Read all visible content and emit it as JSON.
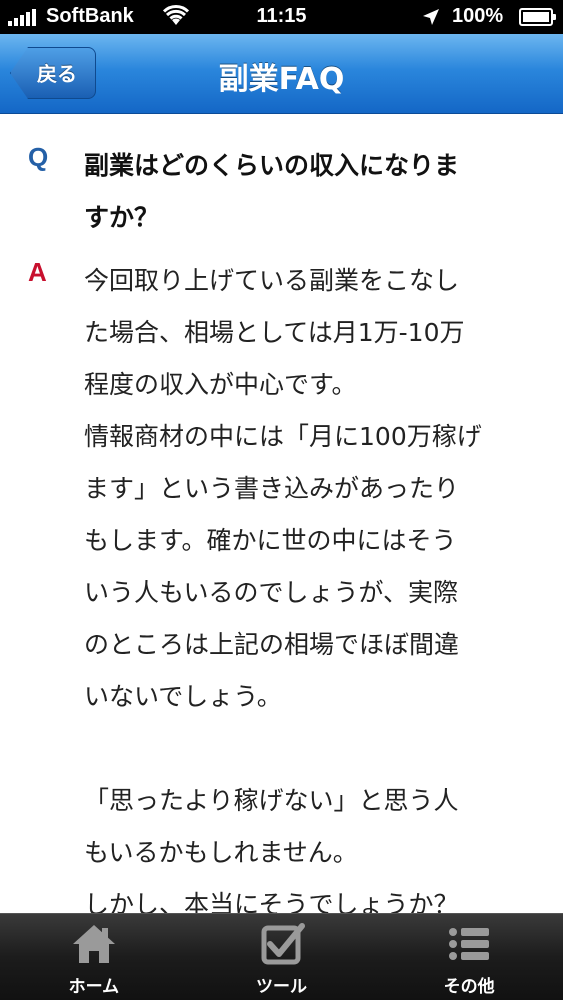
{
  "status_bar": {
    "carrier": "SoftBank",
    "time": "11:15",
    "battery": "100%",
    "icons": [
      "signal-icon",
      "wifi-icon",
      "location-arrow-icon",
      "battery-icon"
    ]
  },
  "nav": {
    "back_label": "戻る",
    "title": "副業FAQ"
  },
  "faq": {
    "q_marker": "Q",
    "question_lines": [
      "副業はどのくらいの収入になりま",
      "すか？"
    ],
    "a_marker": "A",
    "answer_lines": [
      "今回取り上げている副業をこなし",
      "た場合、相場としては月1万-10万",
      "程度の収入が中心です。",
      "情報商材の中には「月に100万稼げ",
      "ます」という書き込みがあったり",
      "もします。確かに世の中にはそう",
      "いう人もいるのでしょうが、実際",
      "のところは上記の相場でほぼ間違",
      "いないでしょう。",
      "",
      "「思ったより稼げない」と思う人",
      "もいるかもしれません。",
      "しかし、本当にそうでしょうか？"
    ]
  },
  "tabs": [
    {
      "label": "ホーム",
      "icon": "home-icon"
    },
    {
      "label": "ツール",
      "icon": "checkbox-icon"
    },
    {
      "label": "その他",
      "icon": "list-icon"
    }
  ],
  "colors": {
    "nav_blue": "#2a86dc",
    "q_blue": "#2460a7",
    "a_red": "#c8102e",
    "tab_bar": "#1c1c1c"
  }
}
